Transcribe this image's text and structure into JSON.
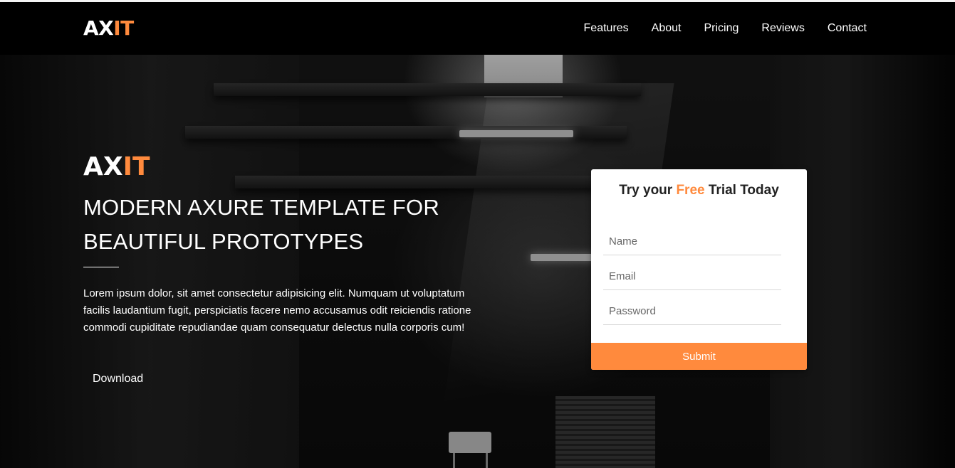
{
  "brand": {
    "part1": "AX",
    "part2": "IT"
  },
  "nav": {
    "items": [
      {
        "label": "Features"
      },
      {
        "label": "About"
      },
      {
        "label": "Pricing"
      },
      {
        "label": "Reviews"
      },
      {
        "label": "Contact"
      }
    ]
  },
  "hero": {
    "title_part1": "AX",
    "title_part2": "IT",
    "subtitle": "MODERN AXURE TEMPLATE FOR BEAUTIFUL PROTOTYPES",
    "description": "Lorem ipsum dolor, sit amet consectetur adipisicing elit. Numquam ut voluptatum facilis laudantium fugit, perspiciatis facere nemo accusamus odit reiciendis ratione commodi cupiditate repudiandae quam consequatur delectus nulla corporis cum!",
    "download_label": "Download"
  },
  "trial_form": {
    "title_before": "Try your ",
    "title_highlight": "Free",
    "title_after": " Trial Today",
    "name_placeholder": "Name",
    "email_placeholder": "Email",
    "password_placeholder": "Password",
    "submit_label": "Submit"
  },
  "colors": {
    "accent": "#ff8a3d",
    "navbar_bg": "#000000",
    "card_bg": "#ffffff",
    "text_light": "#ffffff"
  }
}
